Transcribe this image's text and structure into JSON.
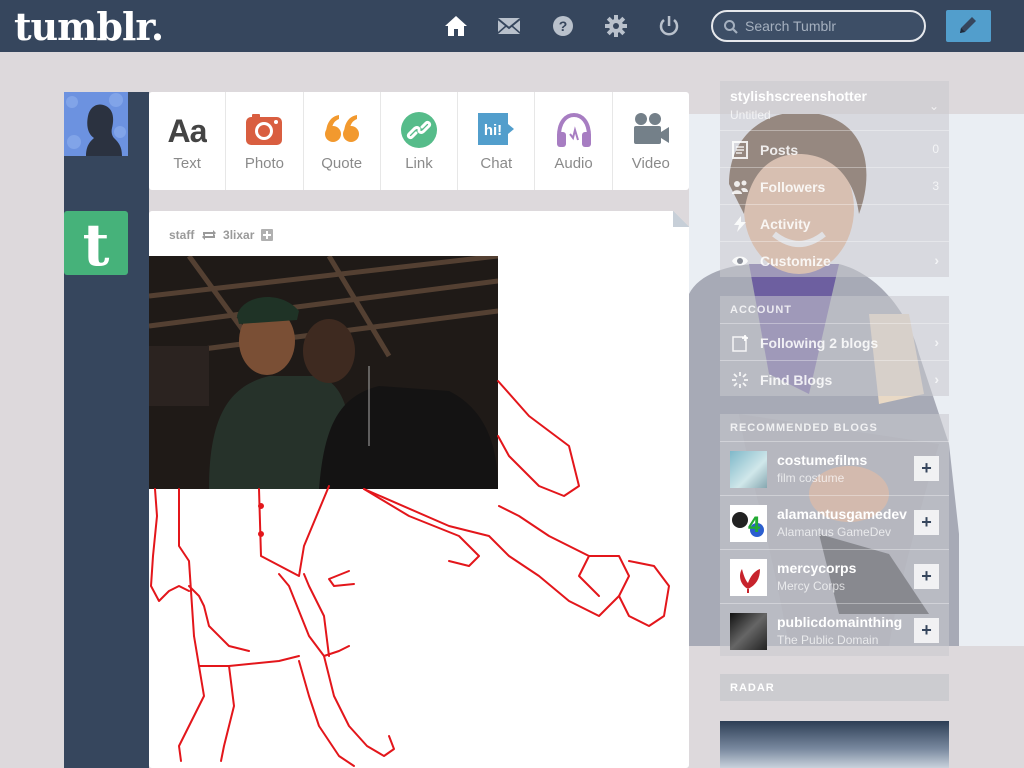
{
  "header": {
    "logo": "tumblr.",
    "search_placeholder": "Search Tumblr",
    "nav_icons": [
      "home-icon",
      "mail-icon",
      "help-icon",
      "gear-icon",
      "power-icon"
    ],
    "compose_icon": "pencil-icon"
  },
  "post_types": [
    {
      "label": "Text",
      "icon": "text-icon",
      "color": "#444444"
    },
    {
      "label": "Photo",
      "icon": "camera-icon",
      "color": "#d95e40"
    },
    {
      "label": "Quote",
      "icon": "quote-icon",
      "color": "#f2992e"
    },
    {
      "label": "Link",
      "icon": "link-icon",
      "color": "#56bc8a"
    },
    {
      "label": "Chat",
      "icon": "chat-icon",
      "color": "#529ecc"
    },
    {
      "label": "Audio",
      "icon": "headphones-icon",
      "color": "#a77dc2"
    },
    {
      "label": "Video",
      "icon": "video-camera-icon",
      "color": "#748089"
    }
  ],
  "post": {
    "author": "staff",
    "reblogged_from": "3lixar"
  },
  "sidebar": {
    "blog_name": "stylishscreenshotter",
    "blog_subtitle": "Untitled",
    "items": [
      {
        "label": "Posts",
        "count": "0",
        "icon": "posts-icon"
      },
      {
        "label": "Followers",
        "count": "3",
        "icon": "followers-icon"
      },
      {
        "label": "Activity",
        "count": "",
        "icon": "activity-icon"
      },
      {
        "label": "Customize",
        "count": "",
        "icon": "eye-icon"
      }
    ],
    "account_head": "ACCOUNT",
    "account_items": [
      {
        "label": "Following 2 blogs",
        "icon": "following-icon"
      },
      {
        "label": "Find Blogs",
        "icon": "find-blogs-icon"
      }
    ],
    "recommended_head": "RECOMMENDED BLOGS",
    "recommended": [
      {
        "name": "costumefilms",
        "title": "film costume"
      },
      {
        "name": "alamantusgamedev",
        "title": "Alamantus GameDev"
      },
      {
        "name": "mercycorps",
        "title": "Mercy Corps"
      },
      {
        "name": "publicdomainthing",
        "title": "The Public Domain"
      }
    ],
    "follow_symbol": "+",
    "radar_head": "RADAR"
  }
}
